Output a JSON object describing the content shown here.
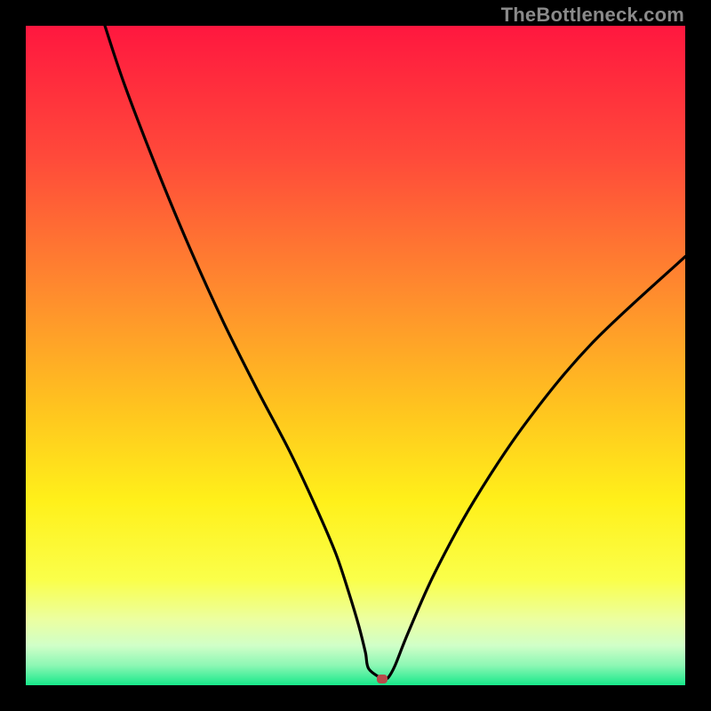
{
  "watermark": "TheBottleneck.com",
  "chart_data": {
    "type": "line",
    "title": "",
    "xlabel": "",
    "ylabel": "",
    "xlim": [
      0,
      100
    ],
    "ylim": [
      0,
      100
    ],
    "grid": false,
    "legend": false,
    "gradient_stops": [
      {
        "offset": 0.0,
        "color": "#ff173f"
      },
      {
        "offset": 0.2,
        "color": "#ff4a3a"
      },
      {
        "offset": 0.4,
        "color": "#ff8a2e"
      },
      {
        "offset": 0.58,
        "color": "#ffc41f"
      },
      {
        "offset": 0.72,
        "color": "#fff01a"
      },
      {
        "offset": 0.84,
        "color": "#faff4a"
      },
      {
        "offset": 0.9,
        "color": "#ecffa0"
      },
      {
        "offset": 0.94,
        "color": "#d0ffc8"
      },
      {
        "offset": 0.97,
        "color": "#8cf7b4"
      },
      {
        "offset": 1.0,
        "color": "#17e88a"
      }
    ],
    "series": [
      {
        "name": "bottleneck-curve",
        "color": "#000000",
        "x": [
          12,
          15,
          20,
          25,
          30,
          35,
          40,
          44,
          47,
          49,
          50.5,
          51.5,
          52,
          54,
          54.5,
          55,
          56,
          58,
          62,
          68,
          76,
          86,
          100
        ],
        "y": [
          100,
          91,
          78,
          66,
          55,
          45,
          35.5,
          27,
          20,
          14,
          9,
          5,
          2.5,
          1,
          1,
          1.2,
          3,
          8,
          17,
          28,
          40,
          52,
          65
        ]
      }
    ],
    "marker": {
      "x": 54,
      "y": 1,
      "color": "#b84a4a"
    }
  }
}
